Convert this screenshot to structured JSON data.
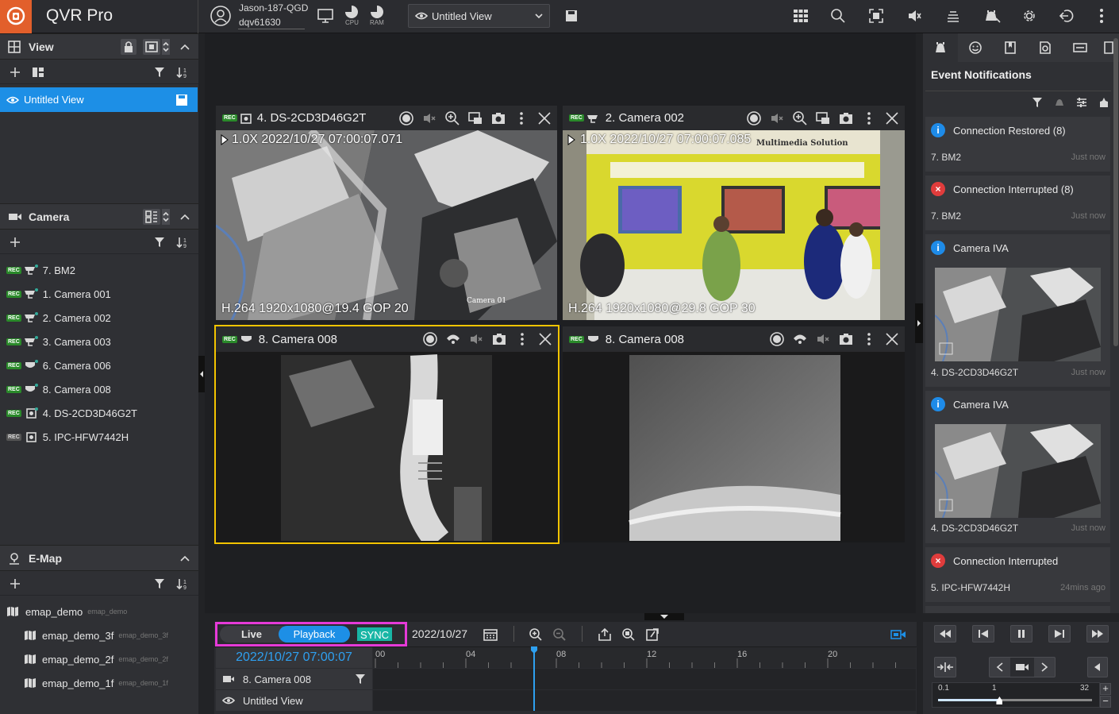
{
  "app": {
    "title": "QVR Pro"
  },
  "topbar": {
    "user_name": "Jason-187-QGD",
    "user_host": "dqv61630",
    "cpu_label": "CPU",
    "ram_label": "RAM",
    "view_select": "Untitled View"
  },
  "left": {
    "view_section": {
      "title": "View",
      "items": [
        {
          "label": "Untitled View"
        }
      ]
    },
    "camera_section": {
      "title": "Camera",
      "items": [
        {
          "label": "7. BM2",
          "rec": "REC"
        },
        {
          "label": "1. Camera 001",
          "rec": "REC"
        },
        {
          "label": "2. Camera 002",
          "rec": "REC"
        },
        {
          "label": "3. Camera 003",
          "rec": "REC"
        },
        {
          "label": "6. Camera 006",
          "rec": "REC"
        },
        {
          "label": "8. Camera 008",
          "rec": "REC"
        },
        {
          "label": "4. DS-2CD3D46G2T",
          "rec": "REC"
        },
        {
          "label": "5. IPC-HFW7442H",
          "rec": "REC"
        }
      ]
    },
    "emap_section": {
      "title": "E-Map",
      "items": [
        {
          "label": "emap_demo",
          "sub": "emap_demo"
        },
        {
          "label": "emap_demo_3f",
          "sub": "emap_demo_3f"
        },
        {
          "label": "emap_demo_2f",
          "sub": "emap_demo_2f"
        },
        {
          "label": "emap_demo_1f",
          "sub": "emap_demo_1f"
        }
      ]
    }
  },
  "tiles": [
    {
      "title": "4. DS-2CD3D46G2T",
      "rec": "REC",
      "overlay_top": "1.0X  2022/10/27 07:00:07.071",
      "overlay_bottom": "H.264 1920x1080@19.4  GOP 20",
      "stamp": "Camera 01"
    },
    {
      "title": "2. Camera 002",
      "rec": "REC",
      "overlay_top": "1.0X  2022/10/27 07:00:07.085",
      "overlay_bottom": "H.264 1920x1080@29.8  GOP 30",
      "sign": "Multimedia Solution"
    },
    {
      "title": "8. Camera 008",
      "rec": "REC"
    },
    {
      "title": "8. Camera 008",
      "rec": "REC"
    }
  ],
  "right": {
    "title": "Event Notifications",
    "notifications": [
      {
        "title": "Connection Restored (8)",
        "source": "7. BM2",
        "time": "Just now",
        "type": "info"
      },
      {
        "title": "Connection Interrupted (8)",
        "source": "7. BM2",
        "time": "Just now",
        "type": "error"
      },
      {
        "title": "Camera IVA",
        "source": "4. DS-2CD3D46G2T",
        "time": "Just now",
        "type": "info"
      },
      {
        "title": "Camera IVA",
        "source": "4. DS-2CD3D46G2T",
        "time": "Just now",
        "type": "info"
      },
      {
        "title": "Connection Interrupted",
        "source": "5. IPC-HFW7442H",
        "time": "24mins ago",
        "type": "error"
      }
    ]
  },
  "timeline": {
    "live_label": "Live",
    "playback_label": "Playback",
    "sync_label": "SYNC",
    "date": "2022/10/27",
    "current_time": "2022/10/27 07:00:07",
    "ticks": [
      "00",
      "04",
      "08",
      "12",
      "16",
      "20"
    ],
    "camera_row": "8. Camera 008",
    "view_row": "Untitled View",
    "cursor_hour": 7.0
  },
  "speed": {
    "min": "0.1",
    "mid": "1",
    "max": "32",
    "value": 1
  }
}
